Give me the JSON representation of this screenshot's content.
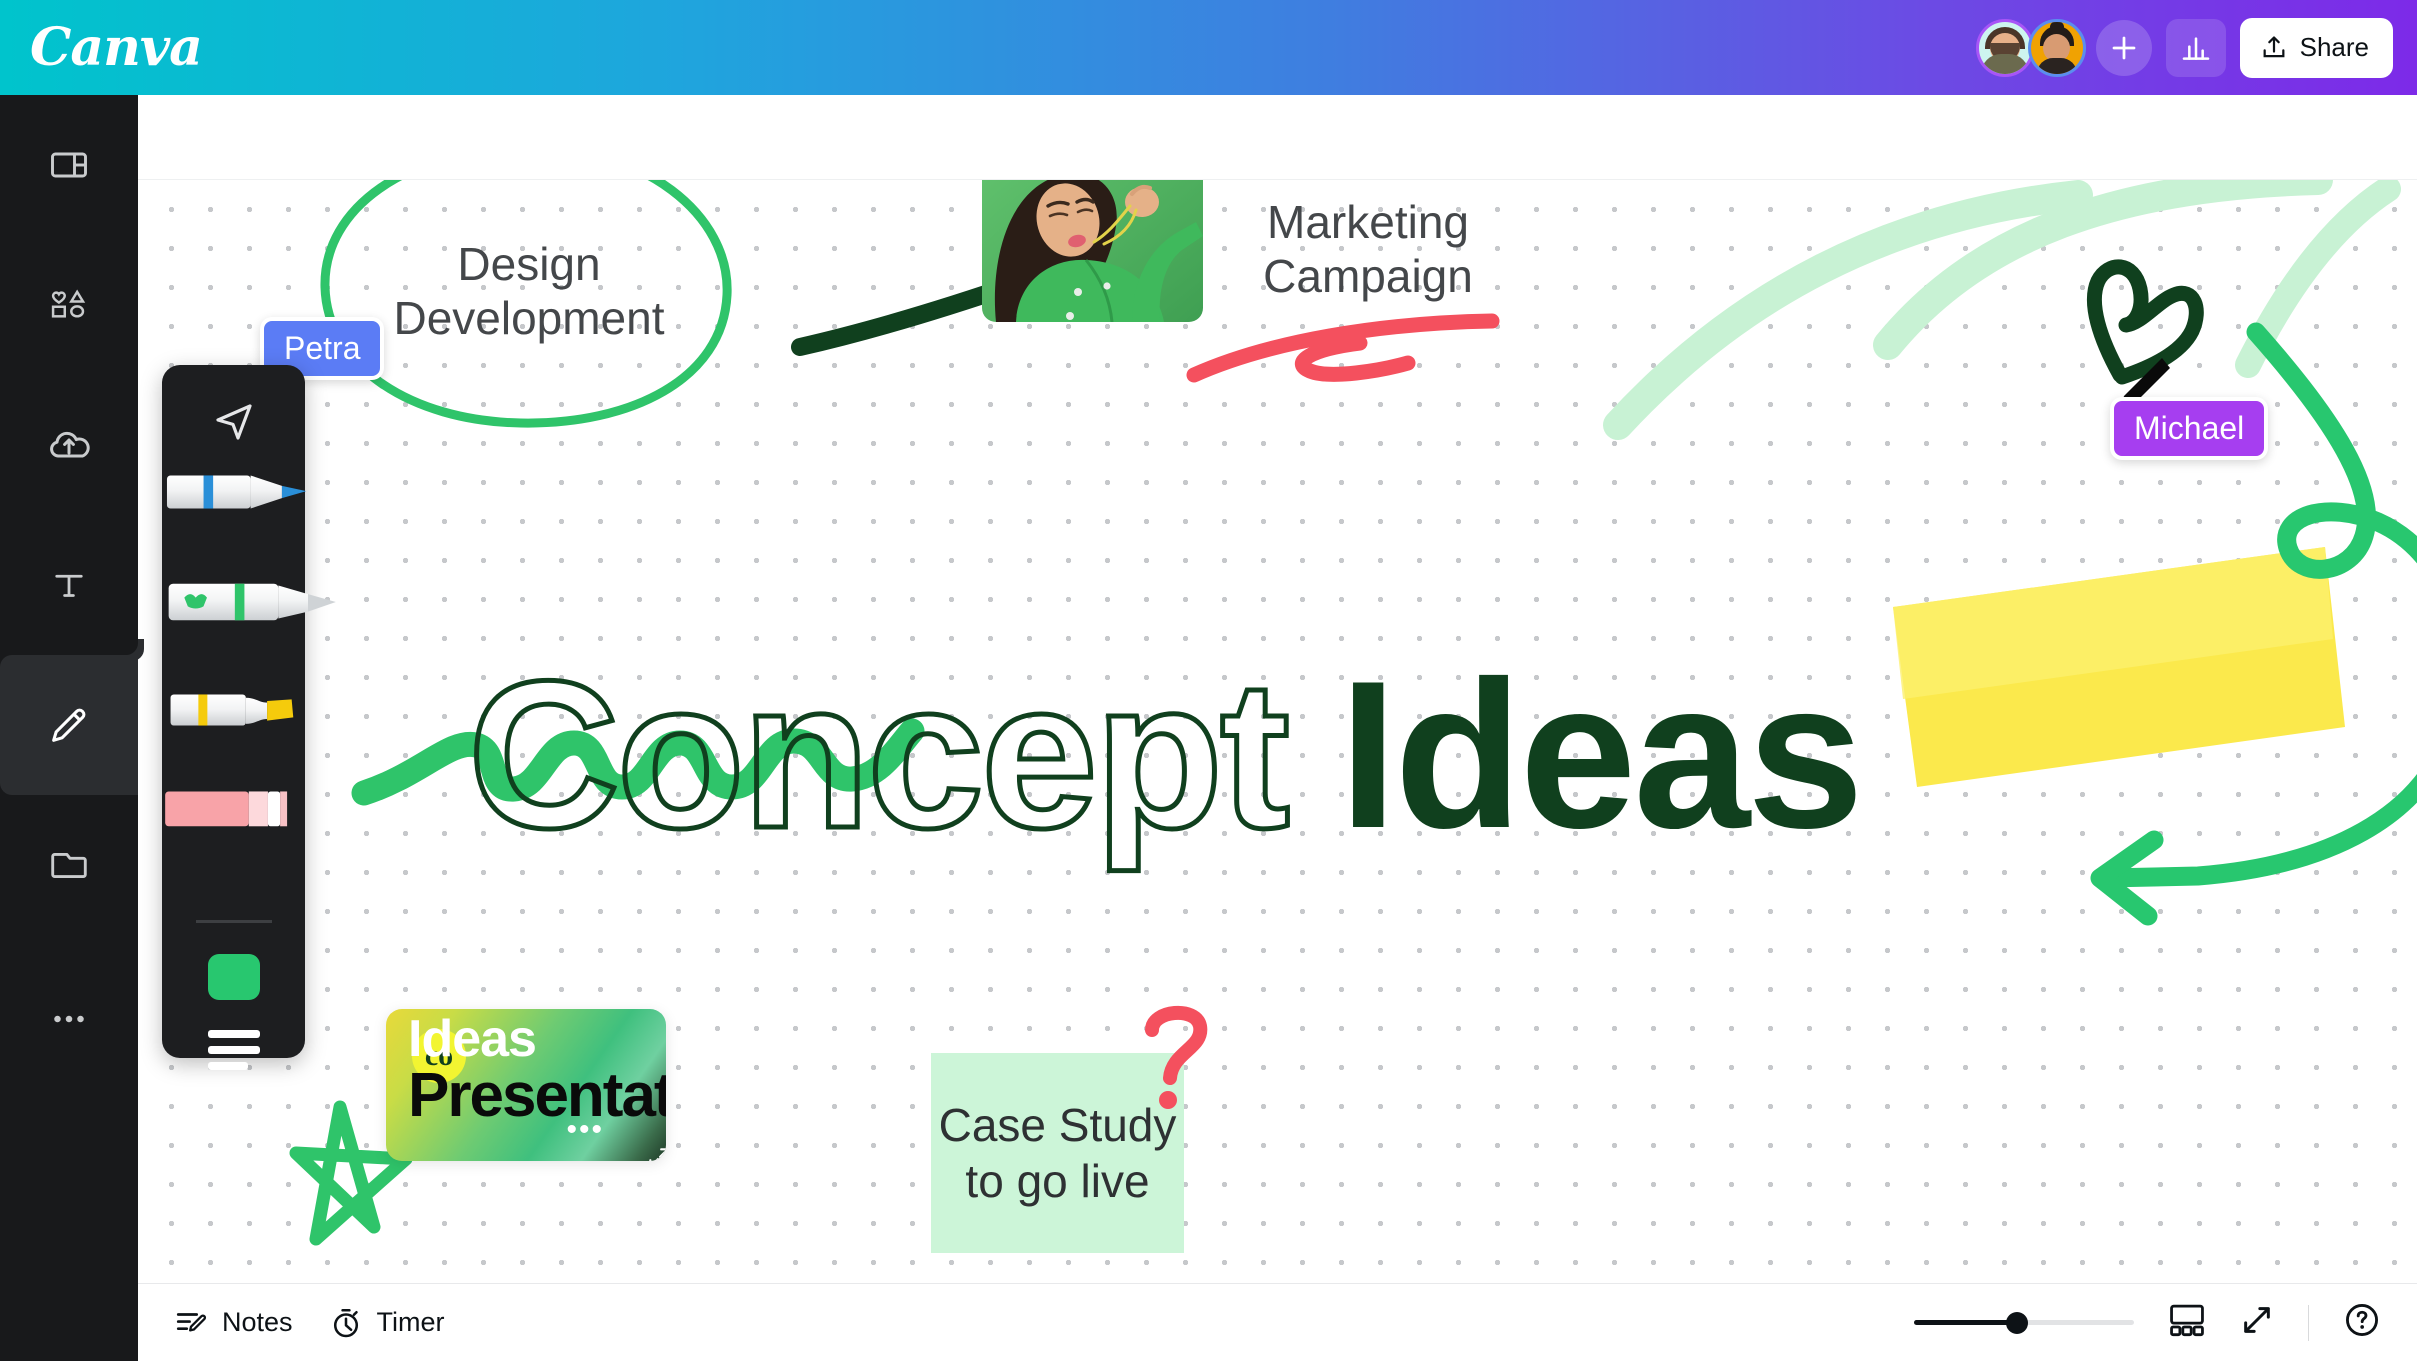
{
  "app": {
    "brand": "Canva",
    "brand_gradient_start": "#00c4cc",
    "brand_gradient_end": "#7d2ae8"
  },
  "topbar": {
    "avatars": [
      {
        "name": "collaborator-1",
        "ring_color": "#a855f7",
        "bg_color": "#cdf4ef"
      },
      {
        "name": "collaborator-2",
        "ring_color": "#5b8def",
        "bg_color": "#f0a202"
      }
    ],
    "add_collaborator_icon": "plus-icon",
    "analytics_icon": "bar-chart-icon",
    "share_label": "Share",
    "share_icon": "upload-icon"
  },
  "sidebar": {
    "items": [
      {
        "label": "Design",
        "icon": "layout-icon",
        "active": false
      },
      {
        "label": "Elements",
        "icon": "shapes-icon",
        "active": false
      },
      {
        "label": "Uploads",
        "icon": "cloud-upload-icon",
        "active": false
      },
      {
        "label": "Text",
        "icon": "text-t-icon",
        "active": false
      },
      {
        "label": "Draw",
        "icon": "pencil-icon",
        "active": true
      },
      {
        "label": "Projects",
        "icon": "folder-icon",
        "active": false
      },
      {
        "label": "Apps",
        "icon": "more-dots-icon",
        "active": false
      }
    ]
  },
  "draw_toolbar": {
    "select_icon": "cursor-arrow-icon",
    "tools": [
      {
        "name": "pen",
        "color": "#2a8fd8",
        "selected": false
      },
      {
        "name": "marker",
        "color": "#2fc46a",
        "selected": true
      },
      {
        "name": "highlighter",
        "color": "#f5cb0c",
        "selected": false
      },
      {
        "name": "eraser",
        "color": "#f8a3a8",
        "selected": false
      }
    ],
    "color_swatch": "#28c76f",
    "thickness_icon": "stroke-width-icon"
  },
  "canvas": {
    "grid": "dot-grid",
    "objects": {
      "circle_note": {
        "text": "Design\nDevelopment",
        "line1": "Design",
        "line2": "Development",
        "stroke": "#2fc46a"
      },
      "marketing_note": {
        "line1": "Marketing",
        "line2": "Campaign",
        "underline_color": "#f4505e"
      },
      "headline_word_1": "Concept",
      "headline_word_2": "Ideas",
      "headline_outline_color": "#10401e",
      "headline_fill_color": "#10401e",
      "highlight_color": "#fbe94c",
      "scribble_color": "#2fc46a",
      "star_doodle_color": "#2fc46a",
      "heart_doodle_color": "#10401e",
      "arrow_small_color": "#10401e",
      "arrow_large_color": "#28c76f",
      "question_mark_color": "#f4505e",
      "photo": {
        "alt": "woman-in-green-jacket",
        "bg_color": "#55bd63"
      },
      "presentation_card": {
        "logo_text": "co",
        "logo_bg": "#f2f531",
        "title_line1": "Ideas",
        "title_line2": "Presentation",
        "more_icon": "more-dots-icon",
        "expand_icon": "expand-icon"
      },
      "sticky_note": {
        "line1": "Case Study",
        "line2": "to go live",
        "bg_color": "#ccf5d8"
      }
    },
    "cursors": [
      {
        "name": "Petra",
        "color": "#5b7cf5"
      },
      {
        "name": "Michael",
        "color": "#a63ef0"
      }
    ]
  },
  "bottombar": {
    "notes_label": "Notes",
    "notes_icon": "notes-pencil-icon",
    "timer_label": "Timer",
    "timer_icon": "stopwatch-icon",
    "zoom_percent": 47,
    "pages_icon": "pages-grid-icon",
    "fullscreen_icon": "fullscreen-icon",
    "help_icon": "help-question-icon"
  }
}
